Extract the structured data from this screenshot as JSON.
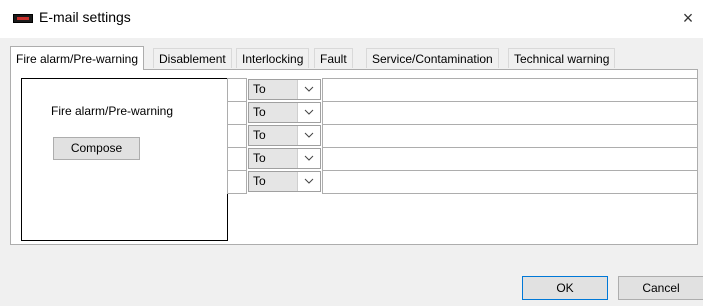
{
  "window": {
    "title": "E-mail settings",
    "close_glyph": "×",
    "icon": "email-settings-app-icon"
  },
  "tabs": [
    {
      "label": "Fire alarm/Pre-warning",
      "active": true
    },
    {
      "label": "Disablement",
      "active": false
    },
    {
      "label": "Interlocking",
      "active": false
    },
    {
      "label": "Fault",
      "active": false
    },
    {
      "label": "Service/Contamination",
      "active": false
    },
    {
      "label": "Technical warning",
      "active": false
    }
  ],
  "group": {
    "label": "Fire alarm/Pre-warning",
    "compose_label": "Compose"
  },
  "recipients": [
    {
      "type": "To",
      "address": ""
    },
    {
      "type": "To",
      "address": ""
    },
    {
      "type": "To",
      "address": ""
    },
    {
      "type": "To",
      "address": ""
    },
    {
      "type": "To",
      "address": ""
    }
  ],
  "buttons": {
    "ok": "OK",
    "cancel": "Cancel"
  }
}
